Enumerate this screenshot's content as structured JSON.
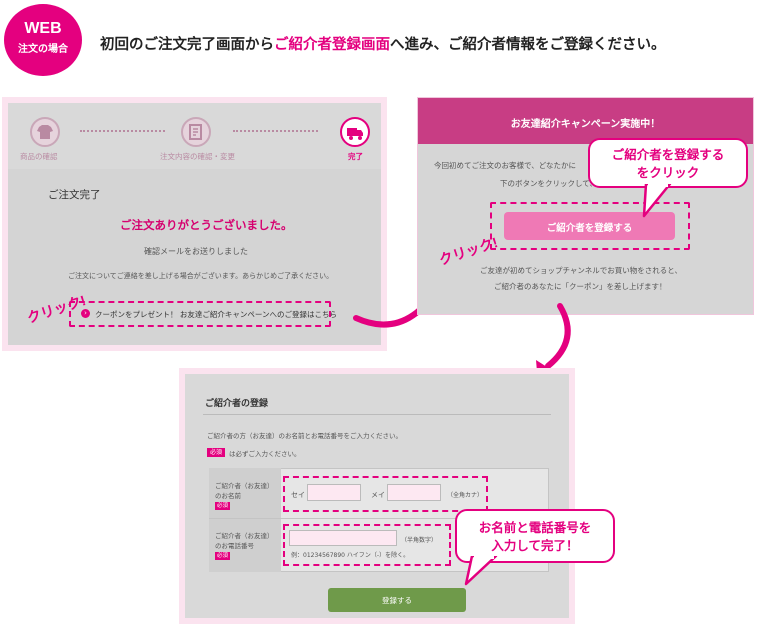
{
  "badge": {
    "line1": "WEB",
    "line2": "注文の場合"
  },
  "headline": {
    "part1": "初回のご注文完了画面から",
    "highlight": "ご紹介者登録画面",
    "part2": "へ進み、ご紹介者情報をご登録ください。"
  },
  "panel1": {
    "steps": [
      "商品の確認",
      "注文内容の確認・変更",
      "完了"
    ],
    "title": "ご注文完了",
    "thanks": "ご注文ありがとうございました。",
    "mail_sent": "確認メールをお送りしました",
    "notice": "ご注文についてご連絡を差し上げる場合がございます。あらかじめご了承ください。",
    "coupon_link": "クーポンをプレゼント！ お友達ご紹介キャンペーンへのご登録はこちら",
    "click_label": "クリック!"
  },
  "panel2": {
    "header": "お友達紹介キャンペーン実施中！",
    "text1": "今回初めてご注文のお客様で、どなたかに",
    "text2": "下のボタンをクリックして、",
    "button": "ご紹介者を登録する",
    "text3": "ご友達が初めてショップチャンネルでお買い物をされると、",
    "text4": "ご紹介者のあなたに「クーポン」を差し上げます！",
    "click_label": "クリック!",
    "callout_line1": "ご紹介者を登録する",
    "callout_line2": "をクリック"
  },
  "panel3": {
    "title": "ご紹介者の登録",
    "intro": "ご紹介者の方（お友達）のお名前とお電話番号をご入力ください。",
    "required_badge": "必須",
    "required_note": "は必ずご入力ください。",
    "name_label1": "ご紹介者（お友達）",
    "name_label2": "のお名前",
    "sei": "セイ",
    "mei": "メイ",
    "name_hint": "（全角カナ）",
    "phone_label1": "ご紹介者（お友達）",
    "phone_label2": "のお電話番号",
    "phone_hint": "（半角数字）",
    "phone_example": "例：01234567890 ハイフン（-）を除く。",
    "submit": "登録する",
    "callout_line1": "お名前と電話番号を",
    "callout_line2": "入力して完了！"
  }
}
